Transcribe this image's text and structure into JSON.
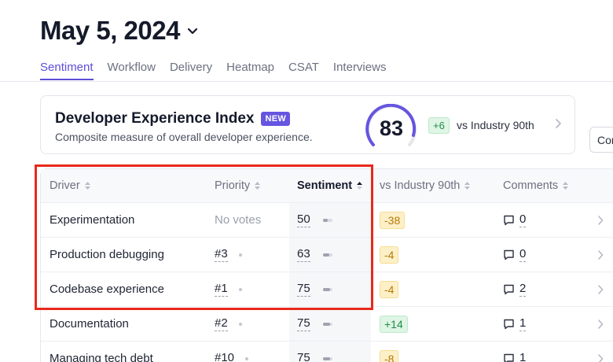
{
  "header": {
    "date": "May 5, 2024"
  },
  "tabs": [
    {
      "label": "Sentiment",
      "active": true
    },
    {
      "label": "Workflow"
    },
    {
      "label": "Delivery"
    },
    {
      "label": "Heatmap"
    },
    {
      "label": "CSAT"
    },
    {
      "label": "Interviews"
    }
  ],
  "dxi": {
    "title": "Developer Experience Index",
    "badge": "NEW",
    "subtitle": "Composite measure of overall developer experience.",
    "score": "83",
    "delta": "+6",
    "vs_label": "vs Industry 90th"
  },
  "side_button": {
    "label": "Com"
  },
  "table": {
    "columns": [
      "Driver",
      "Priority",
      "Sentiment",
      "vs Industry 90th",
      "Comments"
    ],
    "rows": [
      {
        "driver": "Experimentation",
        "priority": "No votes",
        "sentiment": "50",
        "vs": "-38",
        "comments": "0"
      },
      {
        "driver": "Production debugging",
        "priority": "#3",
        "sentiment": "63",
        "vs": "-4",
        "comments": "0"
      },
      {
        "driver": "Codebase experience",
        "priority": "#1",
        "sentiment": "75",
        "vs": "-4",
        "comments": "2"
      },
      {
        "driver": "Documentation",
        "priority": "#2",
        "sentiment": "75",
        "vs": "+14",
        "comments": "1"
      },
      {
        "driver": "Managing tech debt",
        "priority": "#10",
        "sentiment": "75",
        "vs": "-8",
        "comments": "1"
      }
    ]
  },
  "colors": {
    "accent": "#5b4fd8",
    "highlight": "#e8291c",
    "positive": "#1f8f46",
    "negative": "#b5790a"
  }
}
